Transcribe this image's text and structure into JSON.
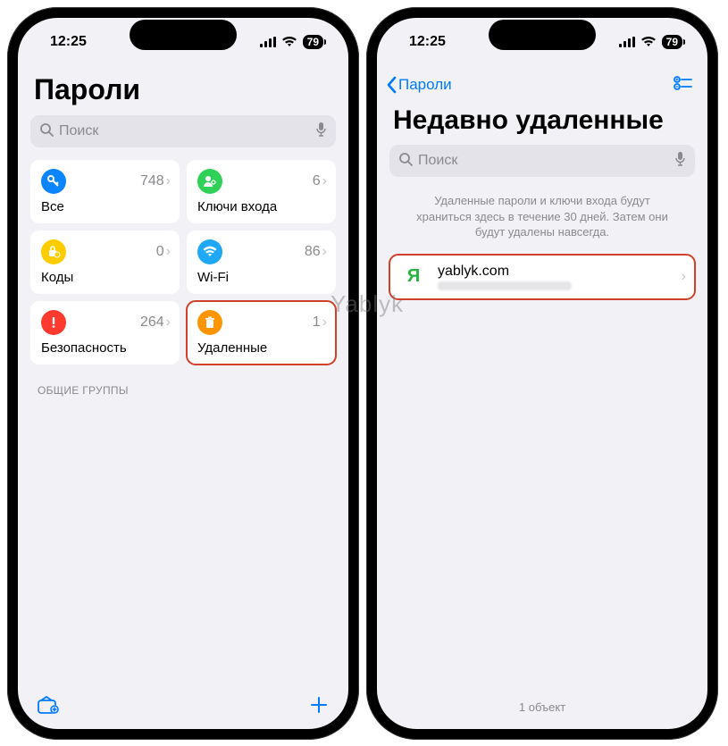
{
  "status": {
    "time": "12:25",
    "battery": "79"
  },
  "left": {
    "title": "Пароли",
    "search_placeholder": "Поиск",
    "tiles": [
      {
        "label": "Все",
        "count": "748"
      },
      {
        "label": "Ключи входа",
        "count": "6"
      },
      {
        "label": "Коды",
        "count": "0"
      },
      {
        "label": "Wi-Fi",
        "count": "86"
      },
      {
        "label": "Безопасность",
        "count": "264"
      },
      {
        "label": "Удаленные",
        "count": "1"
      }
    ],
    "section_header": "ОБЩИЕ ГРУППЫ"
  },
  "right": {
    "back_label": "Пароли",
    "title": "Недавно удаленные",
    "search_placeholder": "Поиск",
    "info": "Удаленные пароли и ключи входа будут храниться здесь в течение 30 дней. Затем они будут удалены навсегда.",
    "row": {
      "badge": "Я",
      "title": "yablyk.com"
    },
    "footer": "1 объект"
  },
  "watermark": "Yablyk"
}
